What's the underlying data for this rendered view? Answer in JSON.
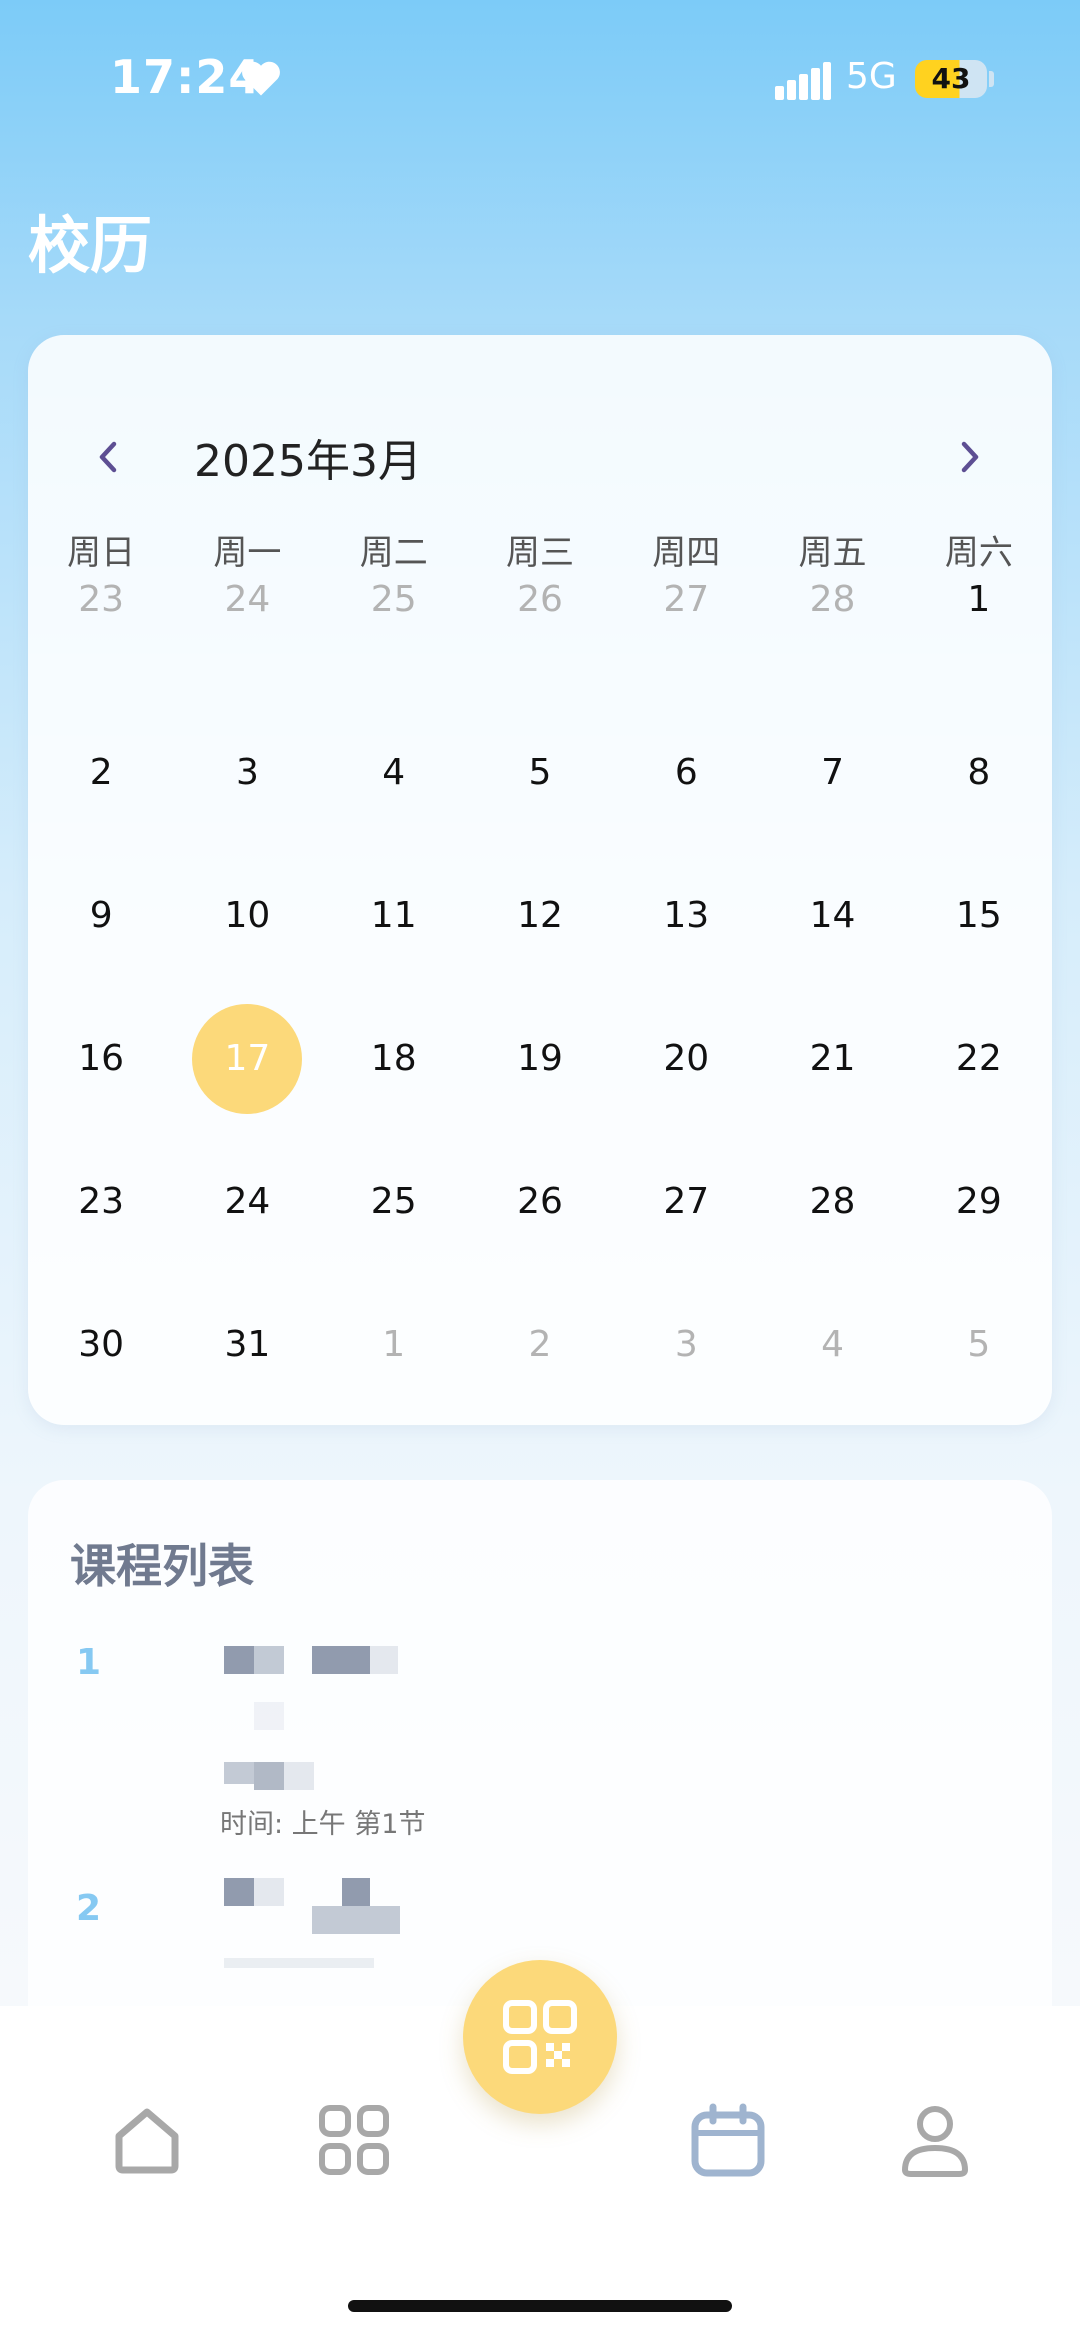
{
  "status_bar": {
    "time": "17:24",
    "network": "5G",
    "battery": "43"
  },
  "page": {
    "title": "校历"
  },
  "calendar": {
    "month_title": "2025年3月",
    "weekdays": [
      "周日",
      "周一",
      "周二",
      "周三",
      "周四",
      "周五",
      "周六"
    ],
    "today": "17",
    "weeks": [
      [
        {
          "d": "23",
          "muted": true
        },
        {
          "d": "24",
          "muted": true
        },
        {
          "d": "25",
          "muted": true
        },
        {
          "d": "26",
          "muted": true
        },
        {
          "d": "27",
          "muted": true
        },
        {
          "d": "28",
          "muted": true
        },
        {
          "d": "1",
          "muted": false
        }
      ],
      [
        {
          "d": "2",
          "muted": false
        },
        {
          "d": "3",
          "muted": false
        },
        {
          "d": "4",
          "muted": false
        },
        {
          "d": "5",
          "muted": false
        },
        {
          "d": "6",
          "muted": false
        },
        {
          "d": "7",
          "muted": false
        },
        {
          "d": "8",
          "muted": false
        }
      ],
      [
        {
          "d": "9",
          "muted": false
        },
        {
          "d": "10",
          "muted": false
        },
        {
          "d": "11",
          "muted": false
        },
        {
          "d": "12",
          "muted": false
        },
        {
          "d": "13",
          "muted": false
        },
        {
          "d": "14",
          "muted": false
        },
        {
          "d": "15",
          "muted": false
        }
      ],
      [
        {
          "d": "16",
          "muted": false
        },
        {
          "d": "17",
          "muted": false
        },
        {
          "d": "18",
          "muted": false
        },
        {
          "d": "19",
          "muted": false
        },
        {
          "d": "20",
          "muted": false
        },
        {
          "d": "21",
          "muted": false
        },
        {
          "d": "22",
          "muted": false
        }
      ],
      [
        {
          "d": "23",
          "muted": false
        },
        {
          "d": "24",
          "muted": false
        },
        {
          "d": "25",
          "muted": false
        },
        {
          "d": "26",
          "muted": false
        },
        {
          "d": "27",
          "muted": false
        },
        {
          "d": "28",
          "muted": false
        },
        {
          "d": "29",
          "muted": false
        }
      ],
      [
        {
          "d": "30",
          "muted": false
        },
        {
          "d": "31",
          "muted": false
        },
        {
          "d": "1",
          "muted": true
        },
        {
          "d": "2",
          "muted": true
        },
        {
          "d": "3",
          "muted": true
        },
        {
          "d": "4",
          "muted": true
        },
        {
          "d": "5",
          "muted": true
        }
      ]
    ]
  },
  "courses": {
    "title": "课程列表",
    "items": [
      {
        "index": "1",
        "time": "时间: 上午 第1节"
      },
      {
        "index": "2"
      }
    ]
  },
  "nav": {
    "tabs": [
      "home-icon",
      "grid-icon",
      "calendar-icon",
      "profile-icon"
    ],
    "active": "calendar-icon",
    "fab": "qr-code-icon"
  },
  "colors": {
    "accent": "#fcd97a",
    "active_tab": "#9fb4cf",
    "inactive_tab": "#a8a8a8",
    "course_index": "#86c9f2"
  }
}
